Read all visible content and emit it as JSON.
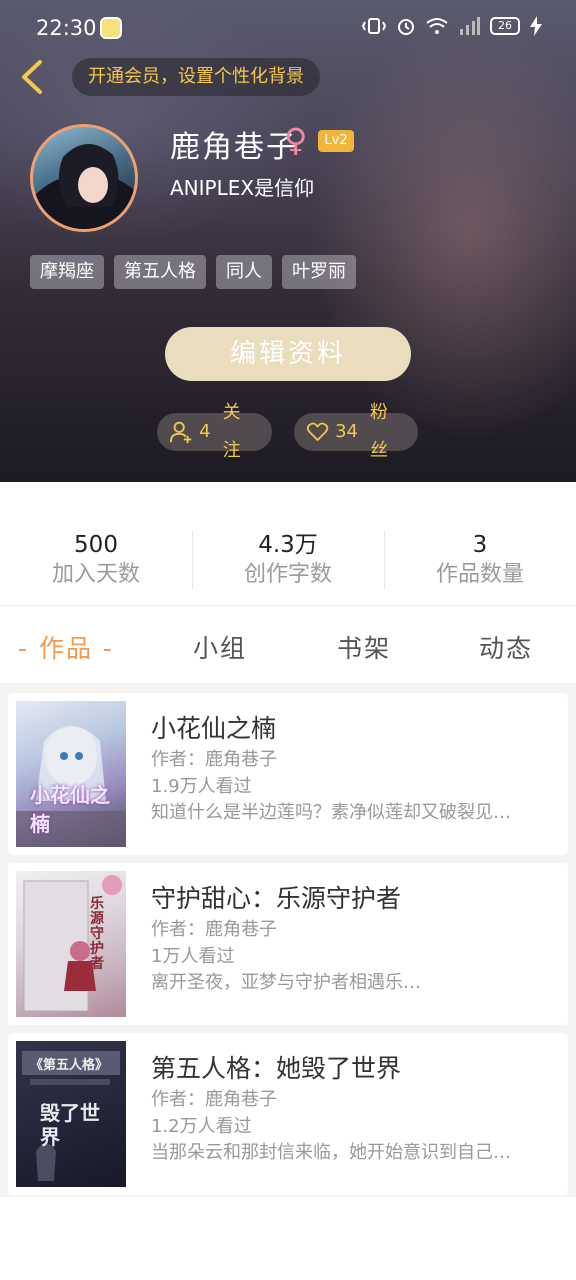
{
  "status_bar": {
    "time": "22:30",
    "battery": "26",
    "icons": [
      "vibrate-icon",
      "alarm-icon",
      "wifi-icon",
      "signal-icon",
      "charging-icon"
    ]
  },
  "header": {
    "vip_prompt": "开通会员，设置个性化背景",
    "username": "鹿角巷子",
    "gender_symbol": "♀",
    "level": "Lv2",
    "signature": "ANIPLEX是信仰",
    "tags": [
      "摩羯座",
      "第五人格",
      "同人",
      "叶罗丽"
    ],
    "edit_button": "编辑资料",
    "follow": {
      "count": "4",
      "label": "关注"
    },
    "fans": {
      "count": "34",
      "label": "粉丝"
    }
  },
  "stats": [
    {
      "value": "500",
      "label": "加入天数"
    },
    {
      "value": "4.3万",
      "label": "创作字数"
    },
    {
      "value": "3",
      "label": "作品数量"
    }
  ],
  "tabs": [
    "- 作品 -",
    "小组",
    "书架",
    "动态"
  ],
  "works": [
    {
      "title": "小花仙之楠",
      "author": "作者：鹿角巷子",
      "views": "1.9万人看过",
      "description": "知道什么是半边莲吗？素净似莲却又破裂见…",
      "cover_text": "小花仙之楠"
    },
    {
      "title": "守护甜心：乐源守护者",
      "author": "作者：鹿角巷子",
      "views": "1万人看过",
      "description": "离开圣夜，亚梦与守护者相遇乐…",
      "cover_text": "乐源守护者"
    },
    {
      "title": "第五人格：她毁了世界",
      "author": "作者：鹿角巷子",
      "views": "1.2万人看过",
      "description": "当那朵云和那封信来临，她开始意识到自己…",
      "cover_text": "毁了世界",
      "cover_subtitle": "《第五人格》"
    }
  ],
  "colors": {
    "accent": "#f09a52",
    "gold": "#f3c84c",
    "edit_button_bg": "#e9ddbd",
    "level_badge": "#f0b63a"
  }
}
